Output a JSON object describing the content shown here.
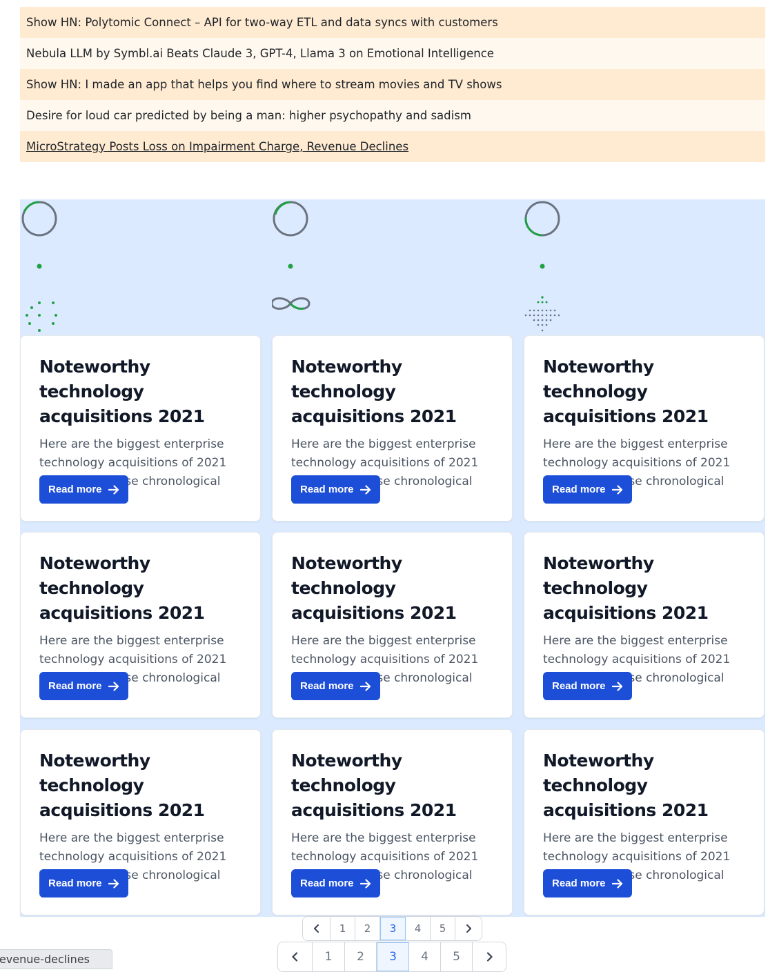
{
  "news": [
    {
      "title": "Show HN: Polytomic Connect – API for two-way ETL and data syncs with customers"
    },
    {
      "title": "Nebula LLM by Symbl.ai Beats Claude 3, GPT-4, Llama 3 on Emotional Intelligence"
    },
    {
      "title": "Show HN: I made an app that helps you find where to stream movies and TV shows"
    },
    {
      "title": "Desire for loud car predicted by being a man: higher psychopathy and sadism"
    },
    {
      "title": "MicroStrategy Posts Loss on Impairment Charge, Revenue Declines"
    }
  ],
  "cards": [
    {
      "title": "Noteworthy technology acquisitions 2021",
      "text": "Here are the biggest enterprise technology acquisitions of 2021 so far, in reverse chronological order.",
      "button": "Read more"
    },
    {
      "title": "Noteworthy technology acquisitions 2021",
      "text": "Here are the biggest enterprise technology acquisitions of 2021 so far, in reverse chronological order.",
      "button": "Read more"
    },
    {
      "title": "Noteworthy technology acquisitions 2021",
      "text": "Here are the biggest enterprise technology acquisitions of 2021 so far, in reverse chronological order.",
      "button": "Read more"
    },
    {
      "title": "Noteworthy technology acquisitions 2021",
      "text": "Here are the biggest enterprise technology acquisitions of 2021 so far, in reverse chronological order.",
      "button": "Read more"
    },
    {
      "title": "Noteworthy technology acquisitions 2021",
      "text": "Here are the biggest enterprise technology acquisitions of 2021 so far, in reverse chronological order.",
      "button": "Read more"
    },
    {
      "title": "Noteworthy technology acquisitions 2021",
      "text": "Here are the biggest enterprise technology acquisitions of 2021 so far, in reverse chronological order.",
      "button": "Read more"
    },
    {
      "title": "Noteworthy technology acquisitions 2021",
      "text": "Here are the biggest enterprise technology acquisitions of 2021 so far, in reverse chronological order.",
      "button": "Read more"
    },
    {
      "title": "Noteworthy technology acquisitions 2021",
      "text": "Here are the biggest enterprise technology acquisitions of 2021 so far, in reverse chronological order.",
      "button": "Read more"
    },
    {
      "title": "Noteworthy technology acquisitions 2021",
      "text": "Here are the biggest enterprise technology acquisitions of 2021 so far, in reverse chronological order.",
      "button": "Read more"
    }
  ],
  "pagination": {
    "pages": [
      "1",
      "2",
      "3",
      "4",
      "5"
    ],
    "current": "3",
    "prev_icon": "chevron-left-icon",
    "next_icon": "chevron-right-icon"
  },
  "status_bar": {
    "text": "evenue-declines"
  },
  "colors": {
    "accent": "#1d4ed8",
    "section_bg": "#dbeafe",
    "news_odd": "#ffebd2",
    "news_even": "#fff8ee",
    "spinner": "#22a045"
  }
}
